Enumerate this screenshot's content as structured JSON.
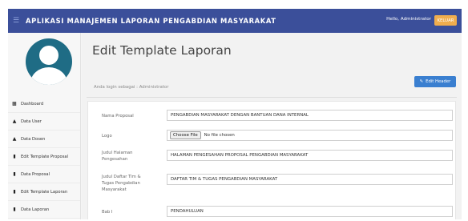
{
  "topbar": {
    "app_title": "APLIKASI MANAJEMEN LAPORAN PENGABDIAN MASYARAKAT",
    "greeting": "Hello, Administrator",
    "logout_label": "KELUAR"
  },
  "sidebar": {
    "items": [
      {
        "label": "Dashboard",
        "icon": "dashboard-icon"
      },
      {
        "label": "Data User",
        "icon": "user-icon"
      },
      {
        "label": "Data Dosen",
        "icon": "user-icon"
      },
      {
        "label": "Edit Template Proposal",
        "icon": "book-icon"
      },
      {
        "label": "Data Proposal",
        "icon": "book-icon"
      },
      {
        "label": "Edit Template Laporan",
        "icon": "book-icon"
      },
      {
        "label": "Data Laporan",
        "icon": "book-icon"
      }
    ]
  },
  "main": {
    "page_title": "Edit Template Laporan",
    "login_info": "Anda login sebagai : Administrator",
    "edit_header_label": "Edit Header",
    "form": {
      "nama_proposal": {
        "label": "Nama Proposal",
        "value": "PENGABDIAN MASYARAKAT DENGAN BANTUAN DANA INTERNAL"
      },
      "logo": {
        "label": "Logo",
        "button": "Choose File",
        "status": "No file chosen"
      },
      "judul_halaman": {
        "label": "Judul Halaman Pengesahan",
        "value": "HALAMAN PENGESAHAN PROPOSAL PENGABDIAN MASYARAKAT"
      },
      "judul_daftar": {
        "label": "Judul Daftar Tim & Tugas Pengabdian Masyarakat",
        "value": "DAFTAR TIM & TUGAS PENGABDIAN MASYARAKAT"
      },
      "bab1": {
        "label": "Bab I",
        "value": "PENDAHULUAN"
      }
    }
  },
  "colors": {
    "topbar": "#3b4f9a",
    "logout_button": "#f0ad4e",
    "primary_button": "#3a7fd0",
    "avatar_bg": "#1f6c85"
  }
}
